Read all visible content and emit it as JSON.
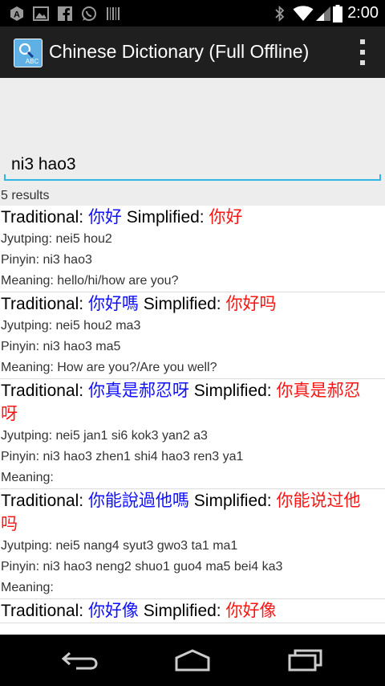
{
  "status_bar": {
    "time": "2:00",
    "left_icons": [
      "notification-a-icon",
      "image-icon",
      "facebook-icon",
      "whatsapp-icon",
      "barcode-icon"
    ],
    "right_icons": [
      "bluetooth-icon",
      "wifi-icon",
      "cell-signal-icon",
      "battery-icon"
    ]
  },
  "app_bar": {
    "title": "Chinese Dictionary (Full Offline)",
    "icon": "dictionary-app-icon",
    "menu_icon": "overflow-menu-icon"
  },
  "search": {
    "value": "ni3 hao3"
  },
  "results_count": "5 results",
  "labels": {
    "traditional": "Traditional: ",
    "simplified": " Simplified: ",
    "jyutping": "Jyutping: ",
    "pinyin": "Pinyin: ",
    "meaning": "Meaning: "
  },
  "results": [
    {
      "traditional": "你好",
      "simplified": "你好",
      "jyutping": "nei5 hou2",
      "pinyin": "ni3 hao3",
      "meaning": "hello/hi/how are you?"
    },
    {
      "traditional": "你好嗎",
      "simplified": "你好吗",
      "jyutping": "nei5 hou2 ma3",
      "pinyin": "ni3 hao3 ma5",
      "meaning": "How are you?/Are you well?"
    },
    {
      "traditional": "你真是郝忍呀",
      "simplified": "你真是郝忍呀",
      "jyutping": "nei5 jan1 si6 kok3 yan2 a3",
      "pinyin": "ni3 hao3 zhen1 shi4 hao3 ren3 ya1",
      "meaning": ""
    },
    {
      "traditional": "你能說過他嗎",
      "simplified": "你能说过他吗",
      "jyutping": "nei5 nang4 syut3 gwo3 ta1 ma1",
      "pinyin": "ni3 hao3 neng2 shuo1 guo4 ma5 bei4 ka3",
      "meaning": ""
    },
    {
      "traditional": "你好像",
      "simplified": "你好像",
      "jyutping": "",
      "pinyin": "",
      "meaning": ""
    }
  ],
  "nav_bar": {
    "back_icon": "back-icon",
    "home_icon": "home-icon",
    "recents_icon": "recent-apps-icon"
  }
}
